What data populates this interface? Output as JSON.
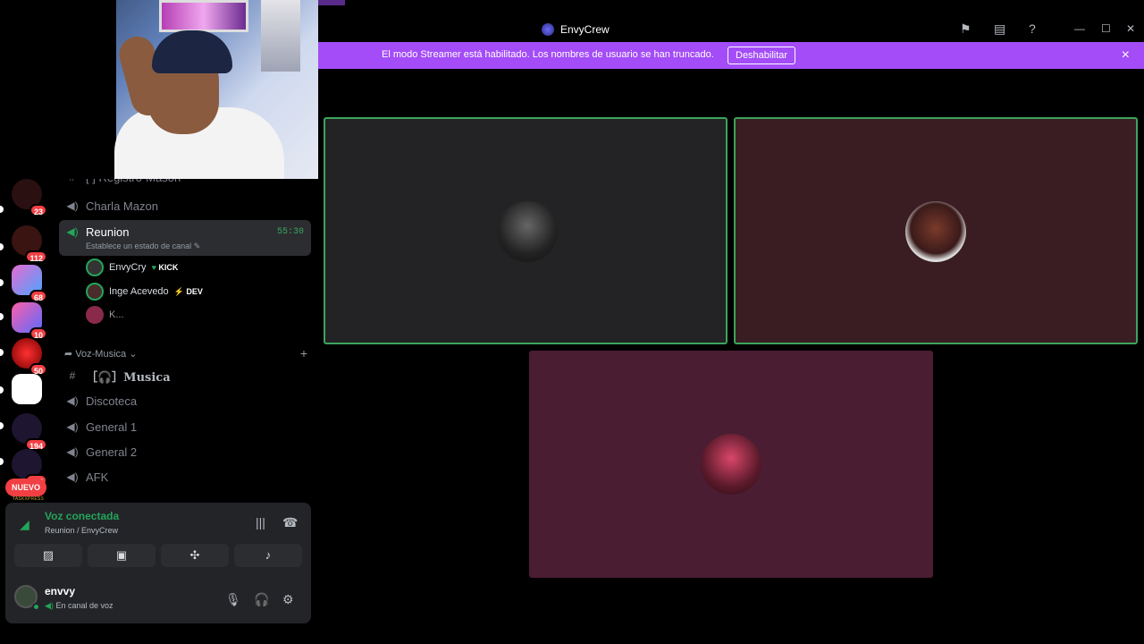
{
  "window": {
    "title": "EnvyCrew"
  },
  "banner": {
    "message": "El modo Streamer está habilitado. Los nombres de usuario se han truncado.",
    "button_label": "Deshabilitar",
    "close_icon": "×"
  },
  "servers": [
    {
      "badge": "23"
    },
    {
      "badge": "112"
    },
    {
      "badge": "68"
    },
    {
      "badge": "10"
    },
    {
      "badge": "50"
    },
    {
      "badge": ""
    },
    {
      "badge": "194"
    },
    {
      "badge": "265"
    }
  ],
  "server_new": {
    "label": "NUEVO",
    "sublabel": "TASKXPRESS"
  },
  "channels": {
    "partial_top": "[ ] Registro-Mason",
    "charla": "Charla Mazon",
    "reunion": {
      "name": "Reunion",
      "timer": "55:30",
      "status": "Establece un estado de canal"
    },
    "members": [
      {
        "name": "EnvyCry",
        "tag": "KICK",
        "tag_icon": "♥"
      },
      {
        "name": "Inge Acevedo",
        "tag": "DEV",
        "tag_icon": "⚡"
      },
      {
        "name": "K...",
        "tag": "",
        "tag_icon": ""
      }
    ],
    "category": "Voz-Musica",
    "musica": "［🎧］Musica",
    "discoteca": "Discoteca",
    "general1": "General 1",
    "general2": "General 2",
    "afk": "AFK"
  },
  "voice": {
    "status": "Voz conectada",
    "location": "Reunion / EnvyCrew"
  },
  "user": {
    "name": "envvy",
    "status": "En canal de voz"
  },
  "colors": {
    "banner": "#a34cf7",
    "speaking": "#3ba55c",
    "tile1": "#232325",
    "tile2": "#3a1d23",
    "tile3": "#4a1d32"
  }
}
